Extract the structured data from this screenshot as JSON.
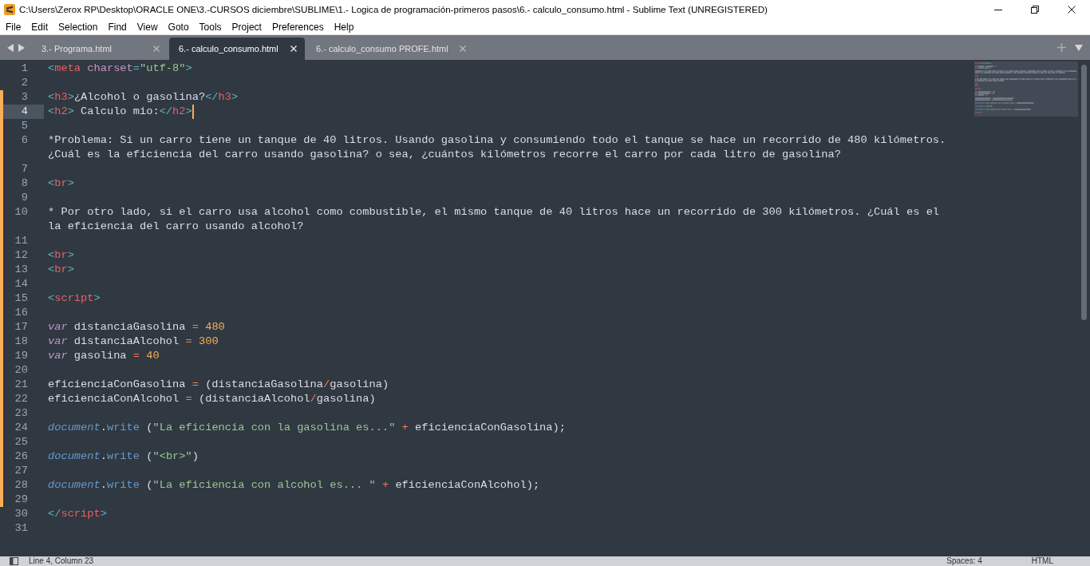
{
  "window": {
    "title": "C:\\Users\\Zerox RP\\Desktop\\ORACLE ONE\\3.-CURSOS diciembre\\SUBLIME\\1.- Logica de programación-primeros pasos\\6.- calculo_consumo.html - Sublime Text (UNREGISTERED)"
  },
  "menu": [
    "File",
    "Edit",
    "Selection",
    "Find",
    "View",
    "Goto",
    "Tools",
    "Project",
    "Preferences",
    "Help"
  ],
  "tabs": [
    {
      "label": "3.- Programa.html",
      "selected": false
    },
    {
      "label": "6.- calculo_consumo.html",
      "selected": true
    },
    {
      "label": "6.- calculo_consumo PROFE.html",
      "selected": false
    }
  ],
  "editor": {
    "lines": [
      {
        "number": "1",
        "modified": false,
        "current": false,
        "tokens": [
          {
            "kind": "punct",
            "text": "<"
          },
          {
            "kind": "tag",
            "text": "meta"
          },
          {
            "kind": "attr",
            "text": " charset"
          },
          {
            "kind": "punct",
            "text": "="
          },
          {
            "kind": "string",
            "text": "\"utf-8\""
          },
          {
            "kind": "punct",
            "text": ">"
          }
        ]
      },
      {
        "number": "2",
        "modified": false,
        "current": false
      },
      {
        "number": "3",
        "modified": true,
        "current": false,
        "tokens": [
          {
            "kind": "punct",
            "text": "<"
          },
          {
            "kind": "tag",
            "text": "h3"
          },
          {
            "kind": "punct",
            "text": ">"
          },
          {
            "kind": "text",
            "text": "¿Alcohol o gasolina?"
          },
          {
            "kind": "punct",
            "text": "</"
          },
          {
            "kind": "tag",
            "text": "h3"
          },
          {
            "kind": "punct",
            "text": ">"
          }
        ]
      },
      {
        "number": "4",
        "modified": true,
        "current": true,
        "tokens": [
          {
            "kind": "punct",
            "text": "<"
          },
          {
            "kind": "tag",
            "text": "h2"
          },
          {
            "kind": "punct",
            "text": ">"
          },
          {
            "kind": "text",
            "text": " Calculo mio:"
          },
          {
            "kind": "punct",
            "text": "</"
          },
          {
            "kind": "tag",
            "text": "h2"
          },
          {
            "kind": "punct",
            "text": ">"
          }
        ]
      },
      {
        "number": "5",
        "modified": true,
        "current": false
      },
      {
        "number": "6",
        "modified": true,
        "current": false,
        "tokens": [
          {
            "kind": "text",
            "text": "*Problema: Si un carro tiene un tanque de 40 litros. Usando gasolina y consumiendo todo el tanque se hace un recorrido de 480 kilómetros. ¿Cuál es la eficiencia del carro usando gasolina? o sea, ¿cuántos kilómetros recorre el carro por cada litro de gasolina?"
          }
        ]
      },
      {
        "number": "7",
        "modified": true,
        "current": false
      },
      {
        "number": "8",
        "modified": true,
        "current": false,
        "tokens": [
          {
            "kind": "punct",
            "text": "<"
          },
          {
            "kind": "tag",
            "text": "br"
          },
          {
            "kind": "punct",
            "text": ">"
          }
        ]
      },
      {
        "number": "9",
        "modified": true,
        "current": false
      },
      {
        "number": "10",
        "modified": true,
        "current": false,
        "tokens": [
          {
            "kind": "text",
            "text": "* Por otro lado, si el carro usa alcohol como combustible, el mismo tanque de 40 litros hace un recorrido de 300 kilómetros. ¿Cuál es el la eficiencia del carro usando alcohol?"
          }
        ]
      },
      {
        "number": "11",
        "modified": true,
        "current": false
      },
      {
        "number": "12",
        "modified": true,
        "current": false,
        "tokens": [
          {
            "kind": "punct",
            "text": "<"
          },
          {
            "kind": "tag",
            "text": "br"
          },
          {
            "kind": "punct",
            "text": ">"
          }
        ]
      },
      {
        "number": "13",
        "modified": true,
        "current": false,
        "tokens": [
          {
            "kind": "punct",
            "text": "<"
          },
          {
            "kind": "tag",
            "text": "br"
          },
          {
            "kind": "punct",
            "text": ">"
          }
        ]
      },
      {
        "number": "14",
        "modified": true,
        "current": false
      },
      {
        "number": "15",
        "modified": true,
        "current": false,
        "tokens": [
          {
            "kind": "punct",
            "text": "<"
          },
          {
            "kind": "tag",
            "text": "script"
          },
          {
            "kind": "punct",
            "text": ">"
          }
        ]
      },
      {
        "number": "16",
        "modified": true,
        "current": false
      },
      {
        "number": "17",
        "modified": true,
        "current": false,
        "tokens": [
          {
            "kind": "keyword",
            "text": "var"
          },
          {
            "kind": "text",
            "text": " distanciaGasolina "
          },
          {
            "kind": "operator",
            "text": "="
          },
          {
            "kind": "number",
            "text": " 480"
          }
        ]
      },
      {
        "number": "18",
        "modified": true,
        "current": false,
        "tokens": [
          {
            "kind": "keyword",
            "text": "var"
          },
          {
            "kind": "text",
            "text": " distanciaAlcohol "
          },
          {
            "kind": "operator",
            "text": "="
          },
          {
            "kind": "number",
            "text": " 300"
          }
        ]
      },
      {
        "number": "19",
        "modified": true,
        "current": false,
        "tokens": [
          {
            "kind": "keyword",
            "text": "var"
          },
          {
            "kind": "text",
            "text": " gasolina "
          },
          {
            "kind": "operator",
            "text": "="
          },
          {
            "kind": "number",
            "text": " 40"
          }
        ]
      },
      {
        "number": "20",
        "modified": true,
        "current": false
      },
      {
        "number": "21",
        "modified": true,
        "current": false,
        "tokens": [
          {
            "kind": "text",
            "text": "eficienciaConGasolina "
          },
          {
            "kind": "operator",
            "text": "="
          },
          {
            "kind": "text",
            "text": " (distanciaGasolina"
          },
          {
            "kind": "operator",
            "text": "/"
          },
          {
            "kind": "text",
            "text": "gasolina)"
          }
        ]
      },
      {
        "number": "22",
        "modified": true,
        "current": false,
        "tokens": [
          {
            "kind": "text",
            "text": "eficienciaConAlcohol "
          },
          {
            "kind": "operator",
            "text": "="
          },
          {
            "kind": "text",
            "text": " (distanciaAlcohol"
          },
          {
            "kind": "operator",
            "text": "/"
          },
          {
            "kind": "text",
            "text": "gasolina)"
          }
        ]
      },
      {
        "number": "23",
        "modified": true,
        "current": false
      },
      {
        "number": "24",
        "modified": true,
        "current": false,
        "tokens": [
          {
            "kind": "object",
            "text": "document"
          },
          {
            "kind": "text",
            "text": "."
          },
          {
            "kind": "method",
            "text": "write"
          },
          {
            "kind": "text",
            "text": " ("
          },
          {
            "kind": "string",
            "text": "\"La eficiencia con la gasolina es...\""
          },
          {
            "kind": "operator",
            "text": " +"
          },
          {
            "kind": "text",
            "text": " eficienciaConGasolina);"
          }
        ]
      },
      {
        "number": "25",
        "modified": true,
        "current": false
      },
      {
        "number": "26",
        "modified": true,
        "current": false,
        "tokens": [
          {
            "kind": "object",
            "text": "document"
          },
          {
            "kind": "text",
            "text": "."
          },
          {
            "kind": "method",
            "text": "write"
          },
          {
            "kind": "text",
            "text": " ("
          },
          {
            "kind": "string",
            "text": "\"<br>\""
          },
          {
            "kind": "text",
            "text": ")"
          }
        ]
      },
      {
        "number": "27",
        "modified": true,
        "current": false
      },
      {
        "number": "28",
        "modified": true,
        "current": false,
        "tokens": [
          {
            "kind": "object",
            "text": "document"
          },
          {
            "kind": "text",
            "text": "."
          },
          {
            "kind": "method",
            "text": "write"
          },
          {
            "kind": "text",
            "text": " ("
          },
          {
            "kind": "string",
            "text": "\"La eficiencia con alcohol es... \""
          },
          {
            "kind": "operator",
            "text": " +"
          },
          {
            "kind": "text",
            "text": " eficienciaConAlcohol);"
          }
        ]
      },
      {
        "number": "29",
        "modified": true,
        "current": false
      },
      {
        "number": "30",
        "modified": false,
        "current": false,
        "tokens": [
          {
            "kind": "punct",
            "text": "</"
          },
          {
            "kind": "tag",
            "text": "script"
          },
          {
            "kind": "punct",
            "text": ">"
          }
        ]
      },
      {
        "number": "31",
        "modified": false,
        "current": false
      }
    ]
  },
  "status_bar": {
    "position": "Line 4, Column 23",
    "indentation": "Spaces: 4",
    "syntax": "HTML"
  }
}
